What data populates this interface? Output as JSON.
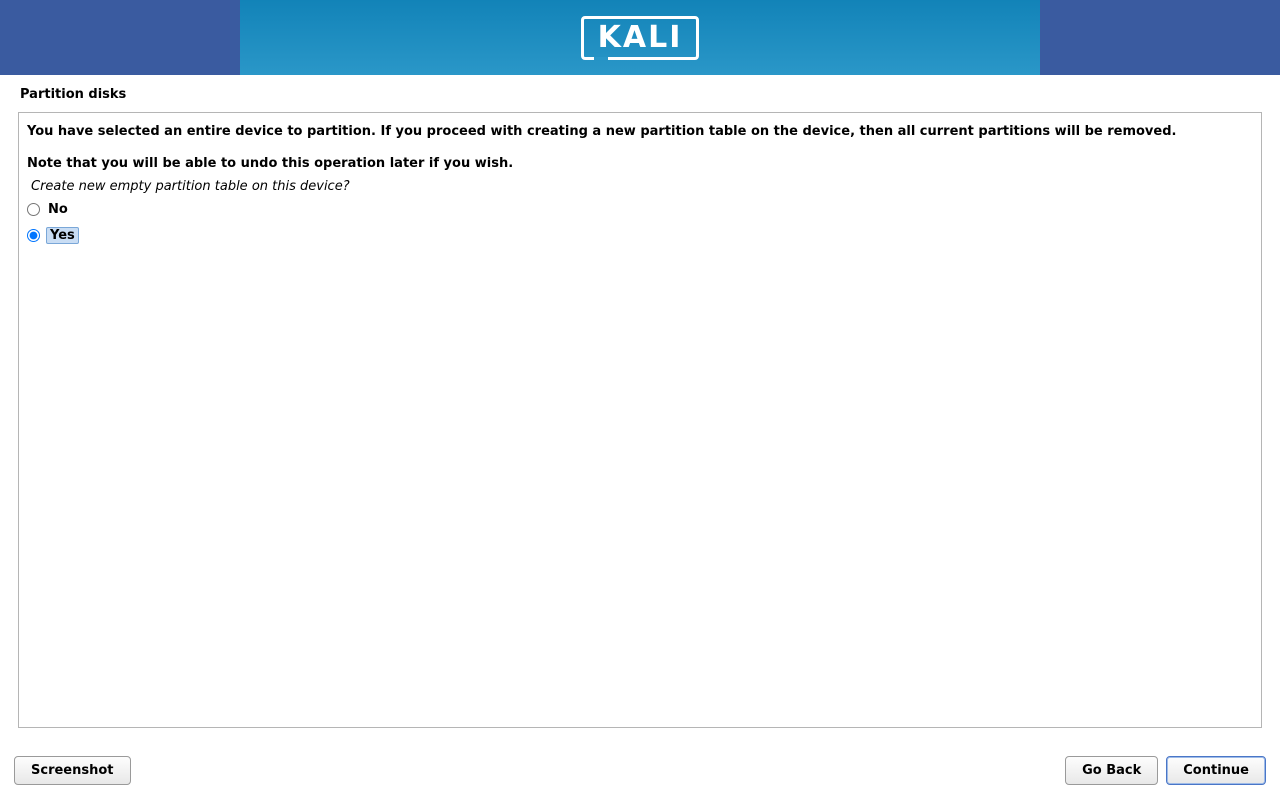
{
  "brand": "KALI",
  "page_title": "Partition disks",
  "warning_line1": "You have selected an entire device to partition. If you proceed with creating a new partition table on the device, then all current partitions will be removed.",
  "warning_line2": "Note that you will be able to undo this operation later if you wish.",
  "question": "Create new empty partition table on this device?",
  "options": {
    "no": "No",
    "yes": "Yes"
  },
  "selected_option": "yes",
  "buttons": {
    "screenshot": "Screenshot",
    "go_back": "Go Back",
    "continue": "Continue"
  }
}
